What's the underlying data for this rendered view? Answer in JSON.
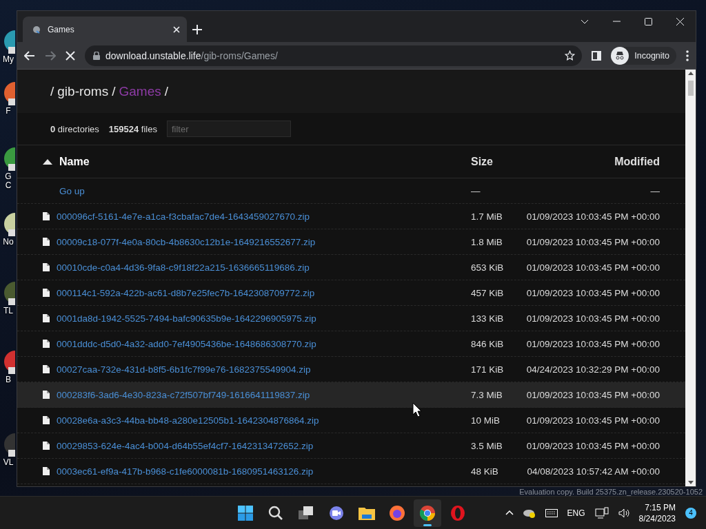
{
  "desktop": {
    "icons": [
      {
        "lines": [
          "My"
        ]
      },
      {
        "lines": [
          "F"
        ]
      },
      {
        "lines": [
          "G",
          "C"
        ]
      },
      {
        "lines": [
          "No"
        ]
      },
      {
        "lines": [
          "TL"
        ]
      },
      {
        "lines": [
          "B"
        ]
      },
      {
        "lines": [
          "VL"
        ]
      }
    ],
    "watermark": "Evaluation copy. Build 25375.zn_release.230520-1052"
  },
  "browser": {
    "tabs": [
      {
        "title": "Games",
        "selected": true
      }
    ],
    "address": {
      "host": "download.unstable.life",
      "path": "/gib-roms/Games/"
    },
    "loading": true,
    "profile": "Incognito"
  },
  "page": {
    "breadcrumb": {
      "separator": "/",
      "items": [
        {
          "text": "gib-roms",
          "current": false
        },
        {
          "text": "Games",
          "current": true
        }
      ]
    },
    "stats": [
      {
        "count": "0",
        "label": "directories"
      },
      {
        "count": "159524",
        "label": "files"
      }
    ],
    "filter": {
      "placeholder": "filter"
    },
    "columns": [
      {
        "label": "Name",
        "sorted": true
      },
      {
        "label": "Size",
        "sorted": false
      },
      {
        "label": "Modified",
        "sorted": false
      }
    ],
    "go_up": {
      "name": "Go up",
      "size": "—",
      "modified": "—"
    },
    "rows": [
      {
        "name": "000096cf-5161-4e7e-a1ca-f3cbafac7de4-1643459027670.zip",
        "size": "1.7 MiB",
        "modified": "01/09/2023 10:03:45 PM +00:00",
        "hovered": false
      },
      {
        "name": "00009c18-077f-4e0a-80cb-4b8630c12b1e-1649216552677.zip",
        "size": "1.8 MiB",
        "modified": "01/09/2023 10:03:45 PM +00:00",
        "hovered": false
      },
      {
        "name": "00010cde-c0a4-4d36-9fa8-c9f18f22a215-1636665119686.zip",
        "size": "653 KiB",
        "modified": "01/09/2023 10:03:45 PM +00:00",
        "hovered": false
      },
      {
        "name": "000114c1-592a-422b-ac61-d8b7e25fec7b-1642308709772.zip",
        "size": "457 KiB",
        "modified": "01/09/2023 10:03:45 PM +00:00",
        "hovered": false
      },
      {
        "name": "0001da8d-1942-5525-7494-bafc90635b9e-1642296905975.zip",
        "size": "133 KiB",
        "modified": "01/09/2023 10:03:45 PM +00:00",
        "hovered": false
      },
      {
        "name": "0001dddc-d5d0-4a32-add0-7ef4905436be-1648686308770.zip",
        "size": "846 KiB",
        "modified": "01/09/2023 10:03:45 PM +00:00",
        "hovered": false
      },
      {
        "name": "00027caa-732e-431d-b8f5-6b1fc7f99e76-1682375549904.zip",
        "size": "171 KiB",
        "modified": "04/24/2023 10:32:29 PM +00:00",
        "hovered": false
      },
      {
        "name": "000283f6-3ad6-4e30-823a-c72f507bf749-1616641119837.zip",
        "size": "7.3 MiB",
        "modified": "01/09/2023 10:03:45 PM +00:00",
        "hovered": true
      },
      {
        "name": "00028e6a-a3c3-44ba-bb48-a280e12505b1-1642304876864.zip",
        "size": "10 MiB",
        "modified": "01/09/2023 10:03:45 PM +00:00",
        "hovered": false
      },
      {
        "name": "00029853-624e-4ac4-b004-d64b55ef4cf7-1642313472652.zip",
        "size": "3.5 MiB",
        "modified": "01/09/2023 10:03:45 PM +00:00",
        "hovered": false
      },
      {
        "name": "0003ec61-ef9a-417b-b968-c1fe6000081b-1680951463126.zip",
        "size": "48 KiB",
        "modified": "04/08/2023 10:57:42 AM +00:00",
        "hovered": false
      }
    ]
  },
  "taskbar": {
    "apps": [
      {
        "kind": "start",
        "active": false
      },
      {
        "kind": "search",
        "active": false
      },
      {
        "kind": "taskview",
        "active": false
      },
      {
        "kind": "chat",
        "active": false
      },
      {
        "kind": "folder",
        "active": false
      },
      {
        "kind": "firefox",
        "active": false
      },
      {
        "kind": "chrome",
        "active": true
      },
      {
        "kind": "opera",
        "active": false
      }
    ],
    "language": "ENG",
    "time": "7:15 PM",
    "date": "8/24/2023",
    "notifications": "4"
  }
}
